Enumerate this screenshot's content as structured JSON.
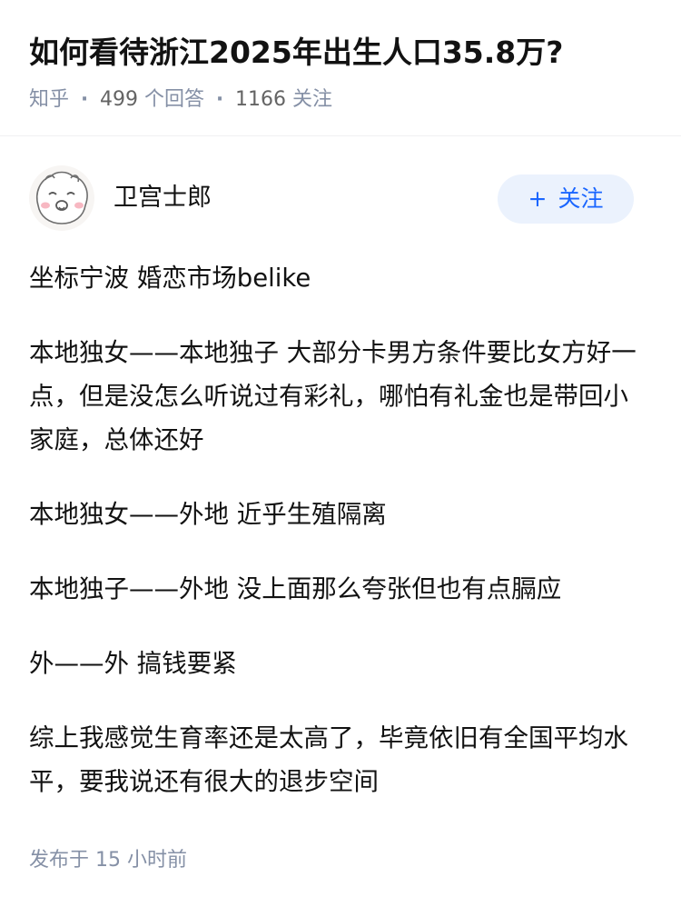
{
  "question": {
    "title": "如何看待浙江2025年出生人口35.8万?",
    "source": "知乎",
    "answer_count": "499",
    "answer_label": "个回答",
    "follower_count": "1166",
    "follower_label": "关注",
    "separator": "·"
  },
  "author": {
    "name": "卫宫士郎",
    "avatar_icon": "cartoon-face-avatar",
    "follow_plus": "+",
    "follow_label": "关注"
  },
  "answer": {
    "paragraphs": [
      "坐标宁波 婚恋市场belike",
      "本地独女——本地独子 大部分卡男方条件要比女方好一点，但是没怎么听说过有彩礼，哪怕有礼金也是带回小家庭，总体还好",
      "本地独女——外地 近乎生殖隔离",
      "本地独子——外地 没上面那么夸张但也有点膈应",
      "外——外 搞钱要紧",
      "综上我感觉生育率还是太高了，毕竟依旧有全国平均水平，要我说还有很大的退步空间"
    ],
    "published": "发布于  15 小时前"
  },
  "colors": {
    "title_text": "#121212",
    "meta_text": "#8590a6",
    "follow_button_bg": "#ebf2fd",
    "follow_button_text": "#1a66ff"
  }
}
